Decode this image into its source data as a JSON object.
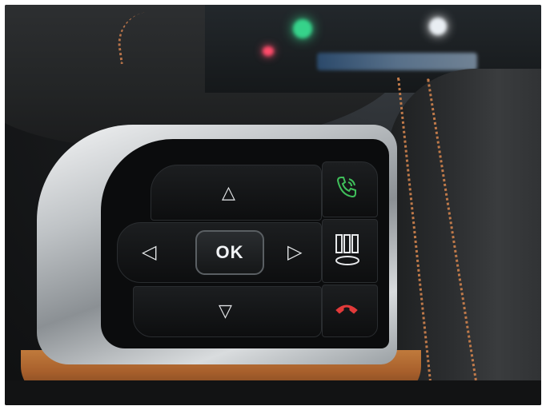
{
  "wheel_buttons": {
    "ok_label": "OK",
    "up_symbol": "△",
    "down_symbol": "▽",
    "left_symbol": "◁",
    "right_symbol": "▷"
  },
  "icons": {
    "voice": "voice-call-icon",
    "phone": "end-call-icon",
    "view": "view-mode-icon"
  },
  "colors": {
    "voice_icon": "#3fbf5a",
    "end_call_icon": "#e23a3a",
    "stitching": "#c07a4a",
    "wood_trim": "#b0652f"
  }
}
